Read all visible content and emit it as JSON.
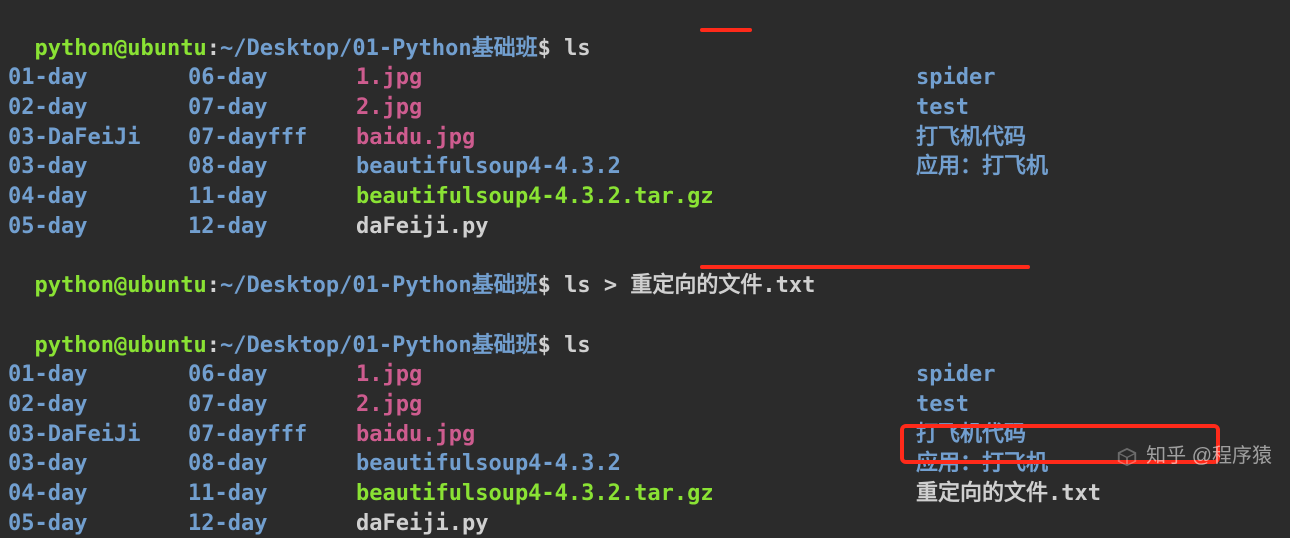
{
  "prompt": {
    "user": "python",
    "at": "@",
    "host": "ubuntu",
    "colon": ":",
    "path": "~/Desktop/01-Python基础班",
    "dollar": "$ "
  },
  "commands": {
    "ls1": "ls",
    "redirect": "ls > 重定向的文件.txt",
    "ls2": "ls"
  },
  "listing1": [
    {
      "c1": {
        "t": "01-day",
        "k": "dir"
      },
      "c2": {
        "t": "06-day",
        "k": "dir"
      },
      "c3": {
        "t": "1.jpg",
        "k": "img"
      },
      "c4": {
        "t": "spider",
        "k": "dir"
      }
    },
    {
      "c1": {
        "t": "02-day",
        "k": "dir"
      },
      "c2": {
        "t": "07-day",
        "k": "dir"
      },
      "c3": {
        "t": "2.jpg",
        "k": "img"
      },
      "c4": {
        "t": "test",
        "k": "dir"
      }
    },
    {
      "c1": {
        "t": "03-DaFeiJi",
        "k": "dir"
      },
      "c2": {
        "t": "07-dayfff",
        "k": "dir"
      },
      "c3": {
        "t": "baidu.jpg",
        "k": "img"
      },
      "c4": {
        "t": "打飞机代码",
        "k": "dir"
      }
    },
    {
      "c1": {
        "t": "03-day",
        "k": "dir"
      },
      "c2": {
        "t": "08-day",
        "k": "dir"
      },
      "c3": {
        "t": "beautifulsoup4-4.3.2",
        "k": "dir"
      },
      "c4": {
        "t": "应用：打飞机",
        "k": "dir"
      }
    },
    {
      "c1": {
        "t": "04-day",
        "k": "dir"
      },
      "c2": {
        "t": "11-day",
        "k": "dir"
      },
      "c3": {
        "t": "beautifulsoup4-4.3.2.tar.gz",
        "k": "exe"
      },
      "c4": {
        "t": "",
        "k": "plain"
      }
    },
    {
      "c1": {
        "t": "05-day",
        "k": "dir"
      },
      "c2": {
        "t": "12-day",
        "k": "dir"
      },
      "c3": {
        "t": "daFeiji.py",
        "k": "plain"
      },
      "c4": {
        "t": "",
        "k": "plain"
      }
    }
  ],
  "listing2": [
    {
      "c1": {
        "t": "01-day",
        "k": "dir"
      },
      "c2": {
        "t": "06-day",
        "k": "dir"
      },
      "c3": {
        "t": "1.jpg",
        "k": "img"
      },
      "c4": {
        "t": "spider",
        "k": "dir"
      }
    },
    {
      "c1": {
        "t": "02-day",
        "k": "dir"
      },
      "c2": {
        "t": "07-day",
        "k": "dir"
      },
      "c3": {
        "t": "2.jpg",
        "k": "img"
      },
      "c4": {
        "t": "test",
        "k": "dir"
      }
    },
    {
      "c1": {
        "t": "03-DaFeiJi",
        "k": "dir"
      },
      "c2": {
        "t": "07-dayfff",
        "k": "dir"
      },
      "c3": {
        "t": "baidu.jpg",
        "k": "img"
      },
      "c4": {
        "t": "打飞机代码",
        "k": "dir"
      }
    },
    {
      "c1": {
        "t": "03-day",
        "k": "dir"
      },
      "c2": {
        "t": "08-day",
        "k": "dir"
      },
      "c3": {
        "t": "beautifulsoup4-4.3.2",
        "k": "dir"
      },
      "c4": {
        "t": "应用：打飞机",
        "k": "dir"
      }
    },
    {
      "c1": {
        "t": "04-day",
        "k": "dir"
      },
      "c2": {
        "t": "11-day",
        "k": "dir"
      },
      "c3": {
        "t": "beautifulsoup4-4.3.2.tar.gz",
        "k": "exe"
      },
      "c4": {
        "t": "重定向的文件.txt",
        "k": "plain"
      }
    },
    {
      "c1": {
        "t": "05-day",
        "k": "dir"
      },
      "c2": {
        "t": "12-day",
        "k": "dir"
      },
      "c3": {
        "t": "daFeiji.py",
        "k": "plain"
      },
      "c4": {
        "t": "",
        "k": "plain"
      }
    }
  ],
  "watermark": "知乎 @程序猿",
  "colors": {
    "bg": "#2b2b2b",
    "user": "#8ae234",
    "path": "#729fcf",
    "img": "#ce5c8f",
    "plain": "#d0d0d0",
    "highlight": "#ff2a1a"
  }
}
